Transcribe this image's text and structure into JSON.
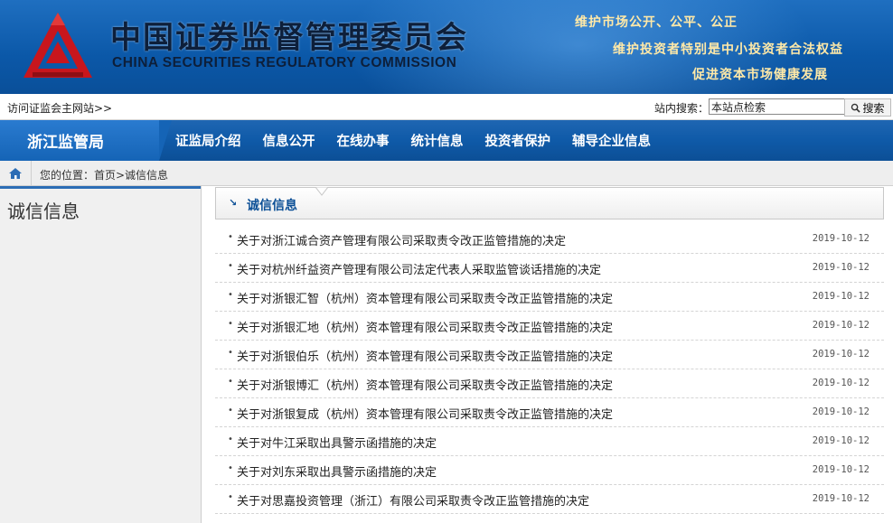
{
  "header": {
    "title_cn": "中国证券监督管理委员会",
    "title_en": "CHINA SECURITIES REGULATORY COMMISSION",
    "slogans": [
      "维护市场公开、公平、公正",
      "维护投资者特别是中小投资者合法权益",
      "促进资本市场健康发展"
    ]
  },
  "topbar": {
    "visit_link": "访问证监会主网站>>",
    "search_label": "站内搜索：",
    "search_value": "本站点检索",
    "search_button": "搜索"
  },
  "nav": {
    "bureau": "浙江监管局",
    "items": [
      "证监局介绍",
      "信息公开",
      "在线办事",
      "统计信息",
      "投资者保护",
      "辅导企业信息"
    ]
  },
  "breadcrumb": "您的位置：首页>诚信信息",
  "sidebar": {
    "title": "诚信信息"
  },
  "section": {
    "title": "诚信信息",
    "marker": "↘"
  },
  "list": [
    {
      "title": "关于对浙江诚合资产管理有限公司采取责令改正监管措施的决定",
      "date": "2019-10-12"
    },
    {
      "title": "关于对杭州纤益资产管理有限公司法定代表人采取监管谈话措施的决定",
      "date": "2019-10-12"
    },
    {
      "title": "关于对浙银汇智（杭州）资本管理有限公司采取责令改正监管措施的决定",
      "date": "2019-10-12"
    },
    {
      "title": "关于对浙银汇地（杭州）资本管理有限公司采取责令改正监管措施的决定",
      "date": "2019-10-12"
    },
    {
      "title": "关于对浙银伯乐（杭州）资本管理有限公司采取责令改正监管措施的决定",
      "date": "2019-10-12"
    },
    {
      "title": "关于对浙银博汇（杭州）资本管理有限公司采取责令改正监管措施的决定",
      "date": "2019-10-12"
    },
    {
      "title": "关于对浙银复成（杭州）资本管理有限公司采取责令改正监管措施的决定",
      "date": "2019-10-12"
    },
    {
      "title": "关于对牛江采取出具警示函措施的决定",
      "date": "2019-10-12"
    },
    {
      "title": "关于对刘东采取出具警示函措施的决定",
      "date": "2019-10-12"
    },
    {
      "title": "关于对思嘉投资管理（浙江）有限公司采取责令改正监管措施的决定",
      "date": "2019-10-12"
    }
  ],
  "colors": {
    "brand_blue": "#0b58a8",
    "logo_red": "#c8161d",
    "slogan_gold": "#ffe9a8"
  }
}
